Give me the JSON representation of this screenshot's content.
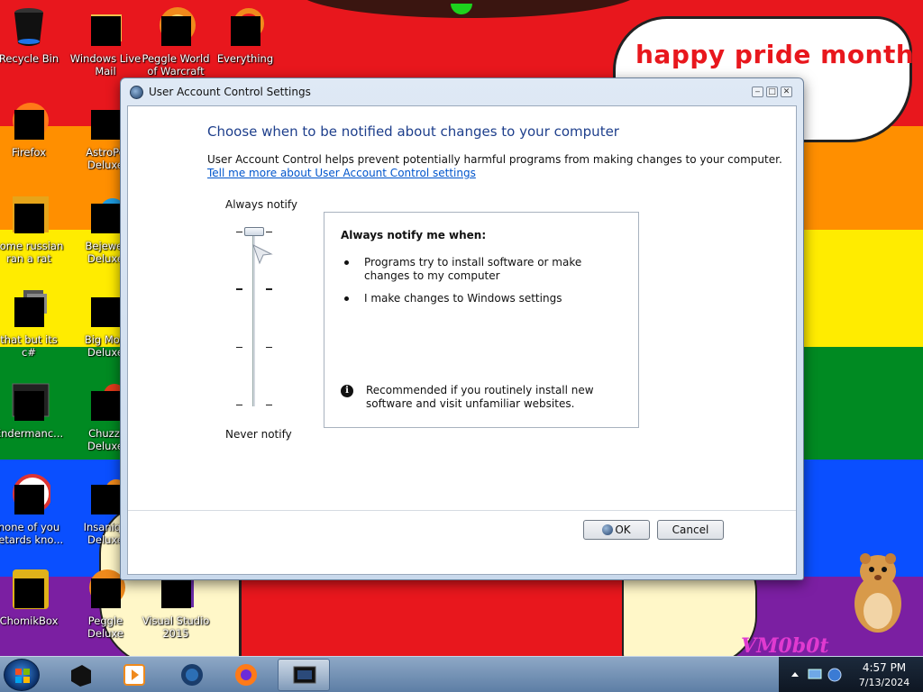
{
  "wallpaper": {
    "speech_bubble": "happy pride month",
    "signature": "VM0b0t",
    "stripe_colors": [
      "#e8171d",
      "#ff8f00",
      "#ffec00",
      "#008a22",
      "#0a4fff",
      "#7b1fa2"
    ]
  },
  "desktop": {
    "icons": [
      {
        "label": "Recycle Bin",
        "icon": "recycle-bin-icon"
      },
      {
        "label": "Windows Live\nMail",
        "icon": "mail-icon"
      },
      {
        "label": "Peggle World\nof Warcraft",
        "icon": "peggle-icon"
      },
      {
        "label": "Everything",
        "icon": "search-icon"
      },
      {
        "label": "Firefox",
        "icon": "firefox-icon"
      },
      {
        "label": "AstroPo\nDeluxe",
        "icon": "game-icon"
      },
      {
        "label": "some russian\nran a rat",
        "icon": "document-icon"
      },
      {
        "label": "Bejewel\nDeluxe",
        "icon": "game-icon"
      },
      {
        "label": "that but its c#",
        "icon": "folder-icon"
      },
      {
        "label": "Big Mon\nDeluxe",
        "icon": "game-icon"
      },
      {
        "label": "Endermanc...",
        "icon": "app-icon"
      },
      {
        "label": "Chuzzl\nDeluxe",
        "icon": "game-icon"
      },
      {
        "label": "none of you\nretards kno...",
        "icon": "app-icon"
      },
      {
        "label": "Insaniqu\nDeluxe",
        "icon": "game-icon"
      },
      {
        "label": "ChomikBox",
        "icon": "chomikbox-icon"
      },
      {
        "label": "Peggle Deluxe",
        "icon": "peggle-icon"
      },
      {
        "label": "Visual Studio\n2015",
        "icon": "visual-studio-icon"
      }
    ]
  },
  "dialog": {
    "title": "User Account Control Settings",
    "heading": "Choose when to be notified about changes to your computer",
    "description": "User Account Control helps prevent potentially harmful programs from making changes to your computer.",
    "help_link": "Tell me more about User Account Control settings",
    "slider": {
      "top_label": "Always notify",
      "bottom_label": "Never notify",
      "levels": 4,
      "selected_level": 4
    },
    "panel": {
      "heading": "Always notify me when:",
      "bullets": [
        "Programs try to install software or make changes to my computer",
        "I make changes to Windows settings"
      ],
      "recommendation": "Recommended if you routinely install new software and visit unfamiliar websites."
    },
    "ok_label": "OK",
    "cancel_label": "Cancel",
    "window_buttons": {
      "minimize": "‒",
      "maximize": "□",
      "close": "✕"
    }
  },
  "taskbar": {
    "items": [
      {
        "name": "taskbar-item-app-1",
        "icon": "black-box-icon",
        "active": false
      },
      {
        "name": "taskbar-item-media",
        "icon": "media-player-icon",
        "active": false
      },
      {
        "name": "taskbar-item-globe",
        "icon": "globe-icon",
        "active": false
      },
      {
        "name": "taskbar-item-firefox",
        "icon": "firefox-icon",
        "active": false
      },
      {
        "name": "taskbar-item-uac",
        "icon": "monitor-icon",
        "active": true
      }
    ],
    "clock": {
      "time": "4:57 PM",
      "date": "7/13/2024"
    }
  }
}
